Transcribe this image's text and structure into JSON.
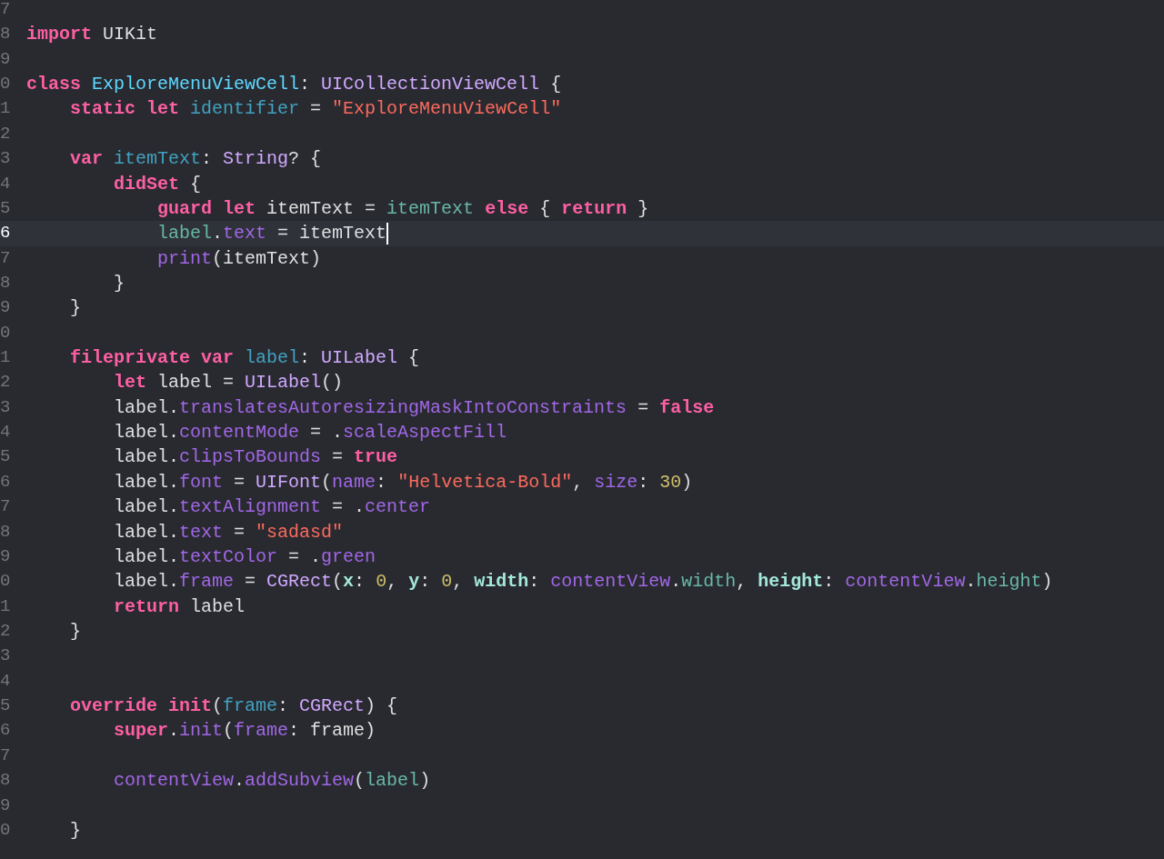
{
  "editor": {
    "lines": [
      {
        "number": "7",
        "current": false,
        "cursor": false
      },
      {
        "number": "8",
        "current": false,
        "cursor": false,
        "tokens": [
          {
            "kind": "keyword",
            "text": "import"
          },
          {
            "kind": "plain",
            "text": " UIKit"
          }
        ]
      },
      {
        "number": "9",
        "current": false,
        "cursor": false
      },
      {
        "number": "0",
        "current": false,
        "cursor": false,
        "tokens": [
          {
            "kind": "keyword",
            "text": "class "
          },
          {
            "kind": "type_decl",
            "text": "ExploreMenuViewCell"
          },
          {
            "kind": "plain",
            "text": ": "
          },
          {
            "kind": "system_type",
            "text": "UICollectionViewCell"
          },
          {
            "kind": "plain",
            "text": " {"
          }
        ]
      },
      {
        "number": "1",
        "current": false,
        "cursor": false,
        "tokens": [
          {
            "kind": "keyword",
            "text": "    static let "
          },
          {
            "kind": "declaration",
            "text": "identifier"
          },
          {
            "kind": "plain",
            "text": " = "
          },
          {
            "kind": "string",
            "text": "\"ExploreMenuViewCell\""
          }
        ]
      },
      {
        "number": "2",
        "current": false,
        "cursor": false
      },
      {
        "number": "3",
        "current": false,
        "cursor": false,
        "tokens": [
          {
            "kind": "keyword",
            "text": "    var "
          },
          {
            "kind": "declaration",
            "text": "itemText"
          },
          {
            "kind": "plain",
            "text": ": "
          },
          {
            "kind": "system_type",
            "text": "String"
          },
          {
            "kind": "plain",
            "text": "? {"
          }
        ]
      },
      {
        "number": "4",
        "current": false,
        "cursor": false,
        "tokens": [
          {
            "kind": "keyword",
            "text": "        didSet"
          },
          {
            "kind": "plain",
            "text": " {"
          }
        ]
      },
      {
        "number": "5",
        "current": false,
        "cursor": false,
        "tokens": [
          {
            "kind": "keyword",
            "text": "            guard let"
          },
          {
            "kind": "plain",
            "text": " itemText = "
          },
          {
            "kind": "project_ref",
            "text": "itemText "
          },
          {
            "kind": "keyword",
            "text": "else"
          },
          {
            "kind": "plain",
            "text": " { "
          },
          {
            "kind": "keyword",
            "text": "return"
          },
          {
            "kind": "plain",
            "text": " }"
          }
        ]
      },
      {
        "number": "6",
        "current": true,
        "cursor": true,
        "tokens": [
          {
            "kind": "project_ref",
            "text": "            label"
          },
          {
            "kind": "plain",
            "text": "."
          },
          {
            "kind": "system_member",
            "text": "text"
          },
          {
            "kind": "plain",
            "text": " = itemText"
          }
        ]
      },
      {
        "number": "7",
        "current": false,
        "cursor": false,
        "tokens": [
          {
            "kind": "system_member",
            "text": "            print"
          },
          {
            "kind": "plain",
            "text": "(itemText)"
          }
        ]
      },
      {
        "number": "8",
        "current": false,
        "cursor": false,
        "tokens": [
          {
            "kind": "plain",
            "text": "        }"
          }
        ]
      },
      {
        "number": "9",
        "current": false,
        "cursor": false,
        "tokens": [
          {
            "kind": "plain",
            "text": "    }"
          }
        ]
      },
      {
        "number": "0",
        "current": false,
        "cursor": false
      },
      {
        "number": "1",
        "current": false,
        "cursor": false,
        "tokens": [
          {
            "kind": "keyword",
            "text": "    fileprivate var "
          },
          {
            "kind": "declaration",
            "text": "label"
          },
          {
            "kind": "plain",
            "text": ": "
          },
          {
            "kind": "system_type",
            "text": "UILabel"
          },
          {
            "kind": "plain",
            "text": " {"
          }
        ]
      },
      {
        "number": "2",
        "current": false,
        "cursor": false,
        "tokens": [
          {
            "kind": "keyword",
            "text": "        let"
          },
          {
            "kind": "plain",
            "text": " label = "
          },
          {
            "kind": "system_type",
            "text": "UILabel"
          },
          {
            "kind": "plain",
            "text": "()"
          }
        ]
      },
      {
        "number": "3",
        "current": false,
        "cursor": false,
        "tokens": [
          {
            "kind": "plain",
            "text": "        label."
          },
          {
            "kind": "system_member",
            "text": "translatesAutoresizingMaskIntoConstraints"
          },
          {
            "kind": "plain",
            "text": " = "
          },
          {
            "kind": "keyword",
            "text": "false"
          }
        ]
      },
      {
        "number": "4",
        "current": false,
        "cursor": false,
        "tokens": [
          {
            "kind": "plain",
            "text": "        label."
          },
          {
            "kind": "system_member",
            "text": "contentMode"
          },
          {
            "kind": "plain",
            "text": " = ."
          },
          {
            "kind": "system_member",
            "text": "scaleAspectFill"
          }
        ]
      },
      {
        "number": "5",
        "current": false,
        "cursor": false,
        "tokens": [
          {
            "kind": "plain",
            "text": "        label."
          },
          {
            "kind": "system_member",
            "text": "clipsToBounds"
          },
          {
            "kind": "plain",
            "text": " = "
          },
          {
            "kind": "keyword",
            "text": "true"
          }
        ]
      },
      {
        "number": "6",
        "current": false,
        "cursor": false,
        "tokens": [
          {
            "kind": "plain",
            "text": "        label."
          },
          {
            "kind": "system_member",
            "text": "font"
          },
          {
            "kind": "plain",
            "text": " = "
          },
          {
            "kind": "system_type",
            "text": "UIFont"
          },
          {
            "kind": "plain",
            "text": "("
          },
          {
            "kind": "system_member",
            "text": "name"
          },
          {
            "kind": "plain",
            "text": ": "
          },
          {
            "kind": "string",
            "text": "\"Helvetica-Bold\""
          },
          {
            "kind": "plain",
            "text": ", "
          },
          {
            "kind": "system_member",
            "text": "size"
          },
          {
            "kind": "plain",
            "text": ": "
          },
          {
            "kind": "number",
            "text": "30"
          },
          {
            "kind": "plain",
            "text": ")"
          }
        ]
      },
      {
        "number": "7",
        "current": false,
        "cursor": false,
        "tokens": [
          {
            "kind": "plain",
            "text": "        label."
          },
          {
            "kind": "system_member",
            "text": "textAlignment"
          },
          {
            "kind": "plain",
            "text": " = ."
          },
          {
            "kind": "system_member",
            "text": "center"
          }
        ]
      },
      {
        "number": "8",
        "current": false,
        "cursor": false,
        "tokens": [
          {
            "kind": "plain",
            "text": "        label."
          },
          {
            "kind": "system_member",
            "text": "text"
          },
          {
            "kind": "plain",
            "text": " = "
          },
          {
            "kind": "string",
            "text": "\"sadasd\""
          }
        ]
      },
      {
        "number": "9",
        "current": false,
        "cursor": false,
        "tokens": [
          {
            "kind": "plain",
            "text": "        label."
          },
          {
            "kind": "system_member",
            "text": "textColor"
          },
          {
            "kind": "plain",
            "text": " = ."
          },
          {
            "kind": "system_member",
            "text": "green"
          }
        ]
      },
      {
        "number": "0",
        "current": false,
        "cursor": false,
        "tokens": [
          {
            "kind": "plain",
            "text": "        label."
          },
          {
            "kind": "system_member",
            "text": "frame"
          },
          {
            "kind": "plain",
            "text": " = "
          },
          {
            "kind": "system_type",
            "text": "CGRect"
          },
          {
            "kind": "plain",
            "text": "("
          },
          {
            "kind": "arg_label",
            "text": "x"
          },
          {
            "kind": "plain",
            "text": ": "
          },
          {
            "kind": "number",
            "text": "0"
          },
          {
            "kind": "plain",
            "text": ", "
          },
          {
            "kind": "arg_label",
            "text": "y"
          },
          {
            "kind": "plain",
            "text": ": "
          },
          {
            "kind": "number",
            "text": "0"
          },
          {
            "kind": "plain",
            "text": ", "
          },
          {
            "kind": "arg_label",
            "text": "width"
          },
          {
            "kind": "plain",
            "text": ": "
          },
          {
            "kind": "system_member",
            "text": "contentView"
          },
          {
            "kind": "plain",
            "text": "."
          },
          {
            "kind": "project_ref",
            "text": "width"
          },
          {
            "kind": "plain",
            "text": ", "
          },
          {
            "kind": "arg_label",
            "text": "height"
          },
          {
            "kind": "plain",
            "text": ": "
          },
          {
            "kind": "system_member",
            "text": "contentView"
          },
          {
            "kind": "plain",
            "text": "."
          },
          {
            "kind": "project_ref",
            "text": "height"
          },
          {
            "kind": "plain",
            "text": ")"
          }
        ]
      },
      {
        "number": "1",
        "current": false,
        "cursor": false,
        "tokens": [
          {
            "kind": "keyword",
            "text": "        return"
          },
          {
            "kind": "plain",
            "text": " label"
          }
        ]
      },
      {
        "number": "2",
        "current": false,
        "cursor": false,
        "tokens": [
          {
            "kind": "plain",
            "text": "    }"
          }
        ]
      },
      {
        "number": "3",
        "current": false,
        "cursor": false
      },
      {
        "number": "4",
        "current": false,
        "cursor": false
      },
      {
        "number": "5",
        "current": false,
        "cursor": false,
        "tokens": [
          {
            "kind": "keyword",
            "text": "    override init"
          },
          {
            "kind": "plain",
            "text": "("
          },
          {
            "kind": "declaration",
            "text": "frame"
          },
          {
            "kind": "plain",
            "text": ": "
          },
          {
            "kind": "system_type",
            "text": "CGRect"
          },
          {
            "kind": "plain",
            "text": ") {"
          }
        ]
      },
      {
        "number": "6",
        "current": false,
        "cursor": false,
        "tokens": [
          {
            "kind": "keyword",
            "text": "        super"
          },
          {
            "kind": "plain",
            "text": "."
          },
          {
            "kind": "system_member",
            "text": "init"
          },
          {
            "kind": "plain",
            "text": "("
          },
          {
            "kind": "system_member",
            "text": "frame"
          },
          {
            "kind": "plain",
            "text": ": frame)"
          }
        ]
      },
      {
        "number": "7",
        "current": false,
        "cursor": false
      },
      {
        "number": "8",
        "current": false,
        "cursor": false,
        "tokens": [
          {
            "kind": "system_member",
            "text": "        contentView"
          },
          {
            "kind": "plain",
            "text": "."
          },
          {
            "kind": "system_member",
            "text": "addSubview"
          },
          {
            "kind": "plain",
            "text": "("
          },
          {
            "kind": "project_ref",
            "text": "label"
          },
          {
            "kind": "plain",
            "text": ")"
          }
        ]
      },
      {
        "number": "9",
        "current": false,
        "cursor": false
      },
      {
        "number": "0",
        "current": false,
        "cursor": false,
        "tokens": [
          {
            "kind": "plain",
            "text": "    }"
          }
        ]
      }
    ]
  }
}
